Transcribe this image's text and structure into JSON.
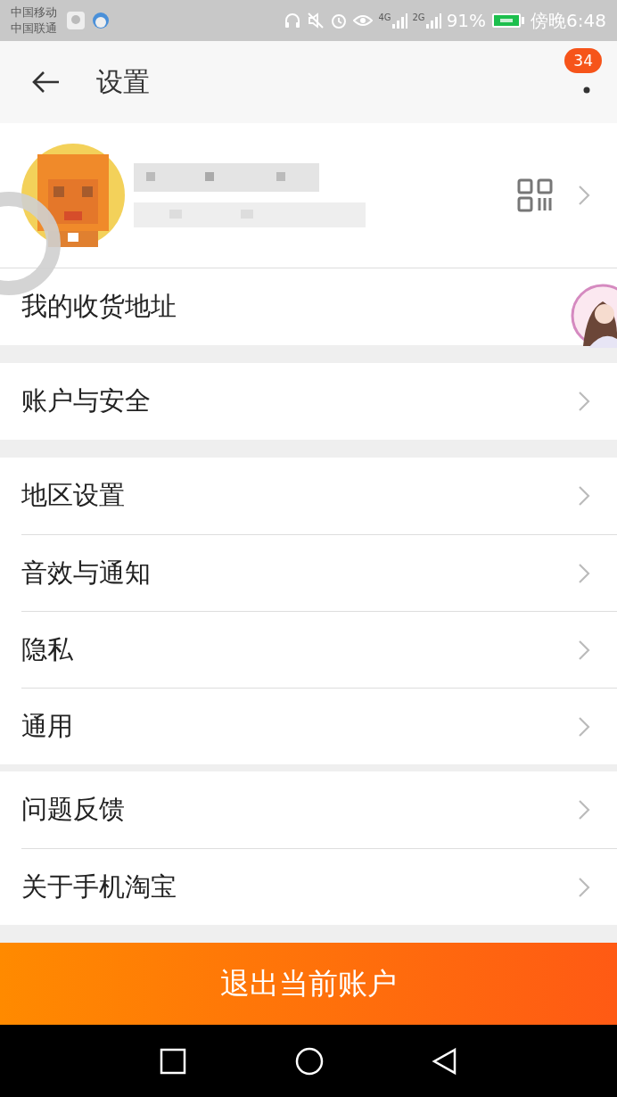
{
  "status_bar": {
    "carriers": [
      "中国移动",
      "中国联通"
    ],
    "signal_labels": [
      "4G",
      "2G"
    ],
    "battery": "91%",
    "time": "傍晚6:48"
  },
  "header": {
    "title": "设置",
    "badge": "34"
  },
  "groups": [
    {
      "items": [
        {
          "label": "我的收货地址",
          "chevron": false
        }
      ]
    },
    {
      "items": [
        {
          "label": "账户与安全",
          "chevron": true
        }
      ]
    },
    {
      "items": [
        {
          "label": "地区设置",
          "chevron": true
        },
        {
          "label": "音效与通知",
          "chevron": true
        },
        {
          "label": "隐私",
          "chevron": true
        },
        {
          "label": "通用",
          "chevron": true
        }
      ]
    },
    {
      "items": [
        {
          "label": "问题反馈",
          "chevron": true
        },
        {
          "label": "关于手机淘宝",
          "chevron": true
        }
      ]
    }
  ],
  "logout_button": "退出当前账户"
}
